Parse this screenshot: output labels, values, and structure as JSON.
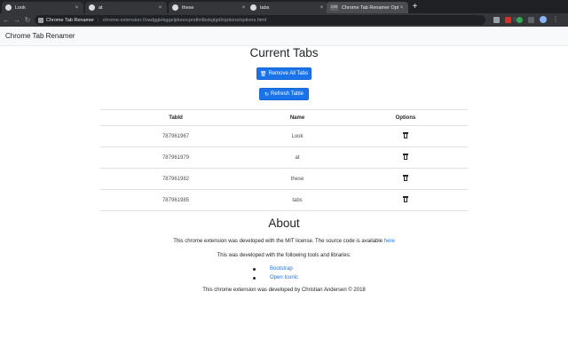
{
  "browser": {
    "tabs": [
      {
        "label": "Look",
        "favicon": "globe-icon"
      },
      {
        "label": "at",
        "favicon": "globe-icon"
      },
      {
        "label": "these",
        "favicon": "globe-icon"
      },
      {
        "label": "tabs",
        "favicon": "globe-icon"
      },
      {
        "label": "Chrome Tab Renamer Options",
        "favicon": "ctr-icon",
        "favicon_text": "CTR"
      }
    ],
    "new_tab_symbol": "+",
    "close_symbol": "×",
    "omnibox": {
      "badge": "Chrome Tab Renamer",
      "separator": "|",
      "url": "chrome-extension://oadggiebggeljdooocpndlmlbokglgdi/options/options.html"
    },
    "ext_colors": [
      "#9aa0a6",
      "#d93025",
      "#34a853",
      "#5f6368"
    ]
  },
  "navbar": {
    "brand": "Chrome Tab Renamer"
  },
  "current_tabs": {
    "heading": "Current Tabs",
    "remove_all_label": "Remove All Tabs",
    "refresh_label": "Refresh Table",
    "columns": [
      "TabId",
      "Name",
      "Options"
    ],
    "rows": [
      {
        "id": "787961967",
        "name": "Look"
      },
      {
        "id": "787961979",
        "name": "at"
      },
      {
        "id": "787961982",
        "name": "these"
      },
      {
        "id": "787961985",
        "name": "tabs"
      }
    ]
  },
  "about": {
    "heading": "About",
    "license_text": "This chrome extension was developed with the MIT license. The source code is available",
    "license_link": "here",
    "tools_text": "This was developed with the following tools and libraries:",
    "tools": [
      "Bootstrap",
      "Open Iconic"
    ],
    "footer": "This chrome extension was developed by Christian Andersen © 2018"
  },
  "colors": {
    "primary": "#1a73e8",
    "chrome_dark": "#202124"
  }
}
